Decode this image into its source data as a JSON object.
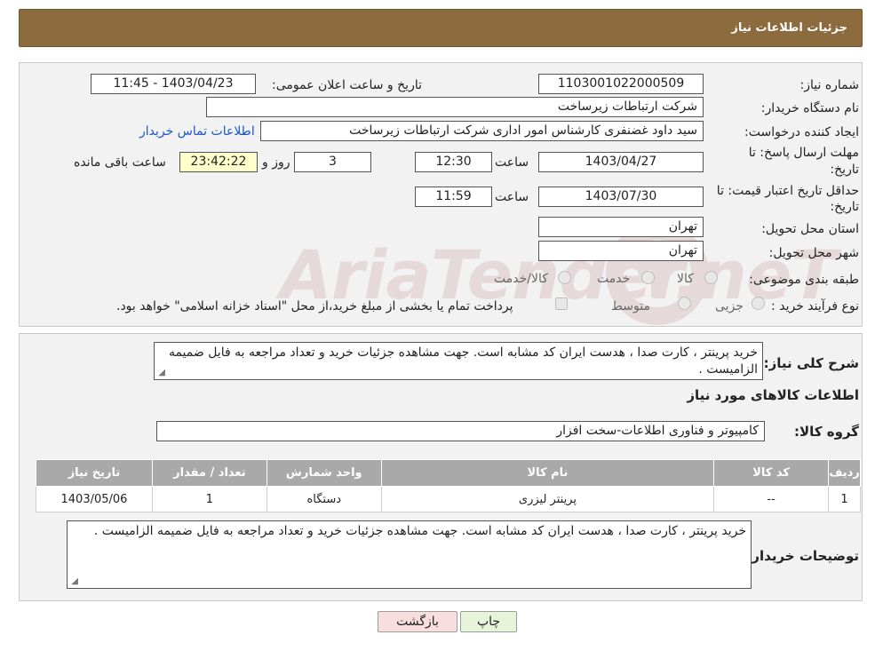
{
  "header": {
    "title": "جزئیات اطلاعات نیاز"
  },
  "form": {
    "need_number_label": "شماره نیاز:",
    "need_number": "1103001022000509",
    "announce_label": "تاریخ و ساعت اعلان عمومی:",
    "announce_value": "1403/04/23 - 11:45",
    "buyer_org_label": "نام دستگاه خریدار:",
    "buyer_org": "شرکت ارتباطات زیرساخت",
    "requester_label": "ایجاد کننده درخواست:",
    "requester": "سید داود غضنفری کارشناس امور اداری شرکت ارتباطات زیرساخت",
    "contact_link": "اطلاعات تماس خریدار",
    "deadline_label_1": "مهلت ارسال پاسخ: تا",
    "deadline_label_2": "تاریخ:",
    "deadline_date": "1403/04/27",
    "time_label": "ساعت",
    "deadline_time": "12:30",
    "days_value": "3",
    "days_label": "روز و",
    "remaining_value": "23:42:22",
    "remaining_label": "ساعت باقی مانده",
    "validity_label_1": "حداقل تاریخ اعتبار قیمت: تا",
    "validity_label_2": "تاریخ:",
    "validity_date": "1403/07/30",
    "validity_time": "11:59",
    "province_label": "استان محل تحویل:",
    "province": "تهران",
    "city_label": "شهر محل تحویل:",
    "city": "تهران",
    "category_label": "طبقه بندی موضوعی:",
    "category_options": [
      "کالا",
      "خدمت",
      "کالا/خدمت"
    ],
    "process_label": "نوع فرآیند خرید :",
    "process_options": [
      "جزیی",
      "متوسط"
    ],
    "process_note": "پرداخت تمام یا بخشی از مبلغ خرید،از محل \"اسناد خزانه اسلامی\" خواهد بود."
  },
  "watermark": {
    "text": "AriaTender.neT"
  },
  "details": {
    "summary_label": "شرح کلی نیاز:",
    "summary": "خرید پرینتر ، کارت صدا ، هدست ایران کد مشابه است. جهت مشاهده جزئیات خرید و تعداد مراجعه به فایل ضمیمه الزامیست .",
    "goods_info_title": "اطلاعات کالاهای مورد نیاز",
    "goods_group_label": "گروه کالا:",
    "goods_group": "کامپیوتر و فناوری اطلاعات-سخت افزار"
  },
  "table": {
    "headers": [
      "ردیف",
      "کد کالا",
      "نام کالا",
      "واحد شمارش",
      "تعداد / مقدار",
      "تاریخ نیاز"
    ],
    "rows": [
      [
        "1",
        "--",
        "پرینتر لیزری",
        "دستگاه",
        "1",
        "1403/05/06"
      ]
    ]
  },
  "buyer_notes": {
    "label": "توضیحات خریدار:",
    "text": "خرید پرینتر ، کارت صدا ، هدست ایران کد مشابه است. جهت مشاهده جزئیات خرید و تعداد مراجعه به فایل ضمیمه الزامیست ."
  },
  "buttons": {
    "print": "چاپ",
    "back": "بازگشت"
  }
}
